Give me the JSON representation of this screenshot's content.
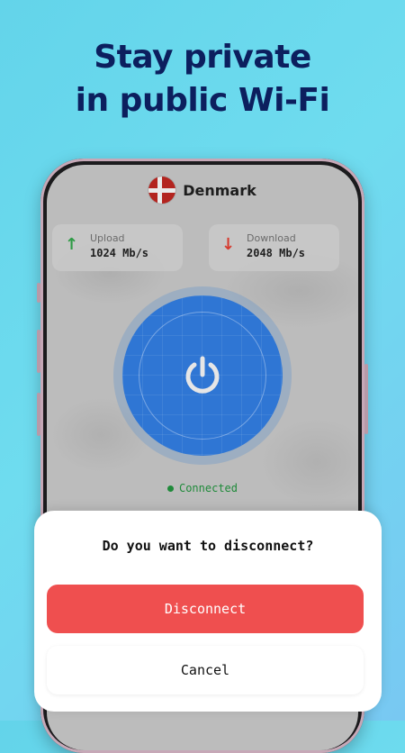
{
  "headline": {
    "line1": "Stay private",
    "line2": "in public Wi-Fi"
  },
  "app": {
    "country": "Denmark",
    "upload": {
      "label": "Upload",
      "value": "1024 Mb/s",
      "arrow": "↑",
      "color": "#2e9b45"
    },
    "download": {
      "label": "Download",
      "value": "2048 Mb/s",
      "arrow": "↓",
      "color": "#d63b2f"
    },
    "status": "Connected"
  },
  "dialog": {
    "question": "Do you want to disconnect?",
    "disconnect_label": "Disconnect",
    "cancel_label": "Cancel"
  },
  "colors": {
    "accent_blue": "#2f76d4",
    "danger_red": "#ef4f4f",
    "connected_green": "#1f8a3a",
    "headline_navy": "#0c1f5e"
  }
}
